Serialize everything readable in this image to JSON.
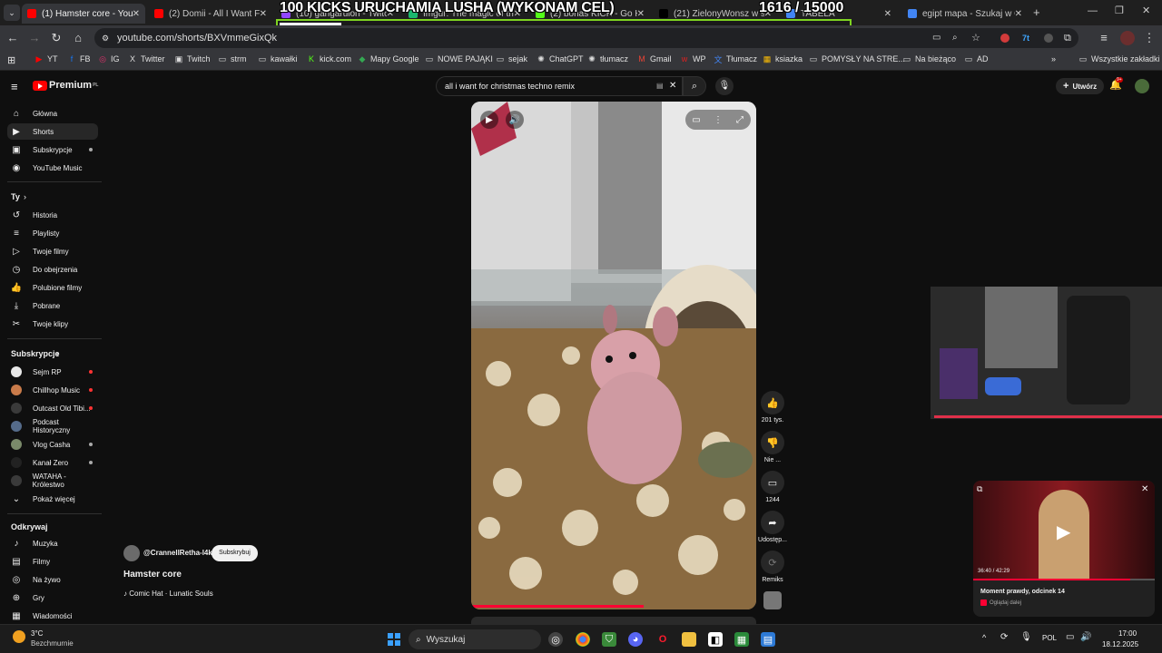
{
  "tabs": [
    {
      "title": "(1) Hamster core - YouTube",
      "active": true
    },
    {
      "title": "(2) Domii - All I Want For Christmas"
    },
    {
      "title": "(10) gangarulon - Twitch"
    },
    {
      "title": "Imgur: The magic of the Internet"
    },
    {
      "title": "(2) bonas KICK - Go Hajo"
    },
    {
      "title": "(21) ZielonyWonsz w serwisie X"
    },
    {
      "title": "TABELA"
    },
    {
      "title": "egipt mapa - Szukaj w Google"
    }
  ],
  "overlay": {
    "title": "100 KICKS URUCHAMIA LUSHA (WYKONAM CEL)",
    "count": "1616",
    "goal": "/ 15000",
    "progress": 0.108
  },
  "address": {
    "url": "youtube.com/shorts/BXVmmeGixQk"
  },
  "bookmarks": [
    {
      "label": "YT",
      "icon": "youtube-icon"
    },
    {
      "label": "FB",
      "icon": "facebook-icon"
    },
    {
      "label": "IG",
      "icon": "instagram-icon"
    },
    {
      "label": "Twitter",
      "icon": "x-icon"
    },
    {
      "label": "Twitch",
      "icon": "twitch-icon"
    },
    {
      "label": "strm",
      "icon": "folder-icon"
    },
    {
      "label": "kawałki",
      "icon": "folder-icon"
    },
    {
      "label": "kick.com",
      "icon": "kick-icon"
    },
    {
      "label": "Mapy Google",
      "icon": "maps-icon"
    },
    {
      "label": "NOWE PAJĄKI",
      "icon": "folder-icon"
    },
    {
      "label": "sejak",
      "icon": "folder-icon"
    },
    {
      "label": "ChatGPT",
      "icon": "chatgpt-icon"
    },
    {
      "label": "tłumacz",
      "icon": "chatgpt-icon"
    },
    {
      "label": "Gmail",
      "icon": "gmail-icon"
    },
    {
      "label": "WP",
      "icon": "wp-icon"
    },
    {
      "label": "Tłumacz",
      "icon": "translate-icon"
    },
    {
      "label": "ksiazka",
      "icon": "grid-icon"
    },
    {
      "label": "POMYSŁY NA STRE...",
      "icon": "folder-icon"
    },
    {
      "label": "Na bieżąco",
      "icon": "folder-icon"
    },
    {
      "label": "AD",
      "icon": "folder-icon"
    }
  ],
  "bookmarks_all": "Wszystkie zakładki",
  "youtube": {
    "logo": "Premium",
    "logo_sup": "PL",
    "search_query": "all i want for christmas techno remix",
    "create_label": "Utwórz",
    "notif_count": "9+",
    "nav": [
      {
        "label": "Główna",
        "icon": "home-icon"
      },
      {
        "label": "Shorts",
        "icon": "shorts-icon",
        "active": true
      },
      {
        "label": "Subskrypcje",
        "icon": "subscriptions-icon"
      },
      {
        "label": "YouTube Music",
        "icon": "music-icon"
      }
    ],
    "you_heading": "Ty",
    "you_items": [
      {
        "label": "Historia",
        "icon": "history-icon"
      },
      {
        "label": "Playlisty",
        "icon": "playlist-icon"
      },
      {
        "label": "Twoje filmy",
        "icon": "video-icon"
      },
      {
        "label": "Do obejrzenia",
        "icon": "clock-icon"
      },
      {
        "label": "Polubione filmy",
        "icon": "like-icon"
      },
      {
        "label": "Pobrane",
        "icon": "download-icon"
      },
      {
        "label": "Twoje klipy",
        "icon": "scissors-icon"
      }
    ],
    "subs_heading": "Subskrypcje",
    "subs": [
      {
        "label": "Sejm RP",
        "live": true,
        "color": "#e8e8e8"
      },
      {
        "label": "Chillhop Music",
        "live": true,
        "color": "#c97b4a"
      },
      {
        "label": "Outcast Old Tibi...",
        "live": true,
        "color": "#3a3a3a"
      },
      {
        "label": "Podcast Historyczny",
        "live": false,
        "color": "#556b8a"
      },
      {
        "label": "Vlog Casha",
        "live": false,
        "color": "#7a8a6a"
      },
      {
        "label": "Kanał Zero",
        "live": false,
        "color": "#222222"
      },
      {
        "label": "WATAHA - Królestwo",
        "live": false,
        "color": "#3a3a3a"
      }
    ],
    "show_more": "Pokaż więcej",
    "explore_heading": "Odkrywaj",
    "explore": [
      {
        "label": "Muzyka",
        "icon": "music-note-icon"
      },
      {
        "label": "Filmy",
        "icon": "film-icon"
      },
      {
        "label": "Na żywo",
        "icon": "live-icon"
      },
      {
        "label": "Gry",
        "icon": "gamepad-icon"
      },
      {
        "label": "Wiadomości",
        "icon": "news-icon"
      }
    ],
    "short": {
      "channel": "@CrannellRetha-l4k",
      "subscribe": "Subskrybuj",
      "title": "Hamster core",
      "music": "♪ Comic Hat · Lunatic Souls",
      "likes": "201 tys.",
      "dislike": "Nie ...",
      "comments": "1244",
      "share": "Udostęp...",
      "remix": "Remiks"
    },
    "miniplayer": {
      "time": "36:40 / 42:29",
      "title": "Moment prawdy, odcinek 14",
      "subtitle": "Oglądaj dalej",
      "progress": 0.863
    }
  },
  "taskbar": {
    "weather_temp": "3°C",
    "weather_desc": "Bezchmurnie",
    "search": "Wyszukaj",
    "lang": "POL",
    "time": "17:00",
    "date": "18.12.2025"
  }
}
